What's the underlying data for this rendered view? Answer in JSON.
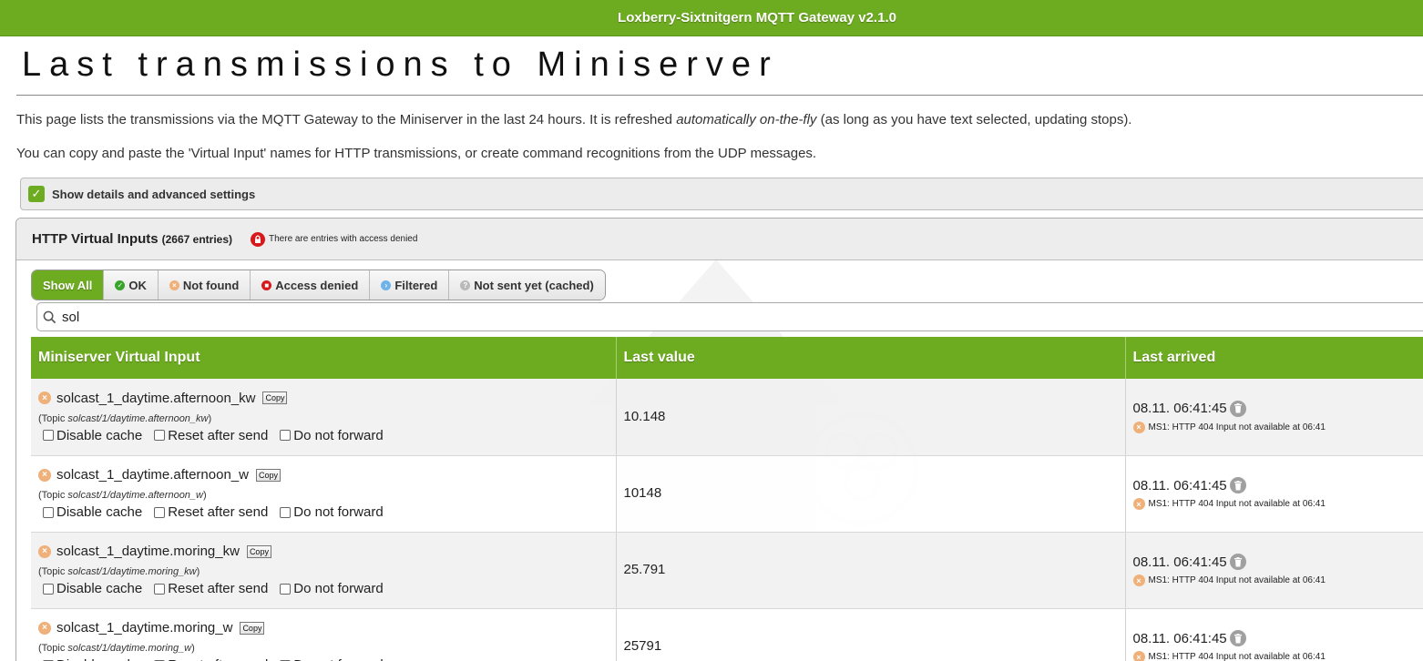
{
  "header": {
    "title": "Loxberry-Sixtnitgern MQTT Gateway v2.1.0"
  },
  "page": {
    "title": "Last transmissions to Miniserver",
    "intro1_before": "This page lists the transmissions via the MQTT Gateway to the Miniserver in the last 24 hours. It is refreshed ",
    "intro1_em": "automatically on-the-fly",
    "intro1_after": " (as long as you have text selected, updating stops).",
    "intro2": "You can copy and paste the 'Virtual Input' names for HTTP transmissions, or create command recognitions from the UDP messages."
  },
  "details": {
    "label": "Show details and advanced settings",
    "checked": true
  },
  "panel": {
    "title": "HTTP Virtual Inputs",
    "count": "(2667 entries)",
    "denied_note": "There are entries with access denied"
  },
  "filters": {
    "show_all": "Show All",
    "ok": "OK",
    "not_found": "Not found",
    "access_denied": "Access denied",
    "filtered": "Filtered",
    "not_sent": "Not sent yet (cached)"
  },
  "search": {
    "value": "sol"
  },
  "table": {
    "columns": [
      "Miniserver Virtual Input",
      "Last value",
      "Last arrived"
    ],
    "copy_label": "Copy",
    "topic_prefix": "(Topic ",
    "topic_suffix": ")",
    "option_labels": [
      "Disable cache",
      "Reset after send",
      "Do not forward"
    ],
    "rows": [
      {
        "name": "solcast_1_daytime.afternoon_kw",
        "topic": "solcast/1/daytime.afternoon_kw",
        "value": "10.148",
        "time": "08.11. 06:41:45",
        "error": "MS1: HTTP 404 Input not available at 06:41"
      },
      {
        "name": "solcast_1_daytime.afternoon_w",
        "topic": "solcast/1/daytime.afternoon_w",
        "value": "10148",
        "time": "08.11. 06:41:45",
        "error": "MS1: HTTP 404 Input not available at 06:41"
      },
      {
        "name": "solcast_1_daytime.moring_kw",
        "topic": "solcast/1/daytime.moring_kw",
        "value": "25.791",
        "time": "08.11. 06:41:45",
        "error": "MS1: HTTP 404 Input not available at 06:41"
      },
      {
        "name": "solcast_1_daytime.moring_w",
        "topic": "solcast/1/daytime.moring_w",
        "value": "25791",
        "time": "08.11. 06:41:45",
        "error": "MS1: HTTP 404 Input not available at 06:41"
      }
    ]
  },
  "colors": {
    "accent": "#6dac20",
    "not_found": "#f0b07a",
    "denied": "#d7191c"
  }
}
